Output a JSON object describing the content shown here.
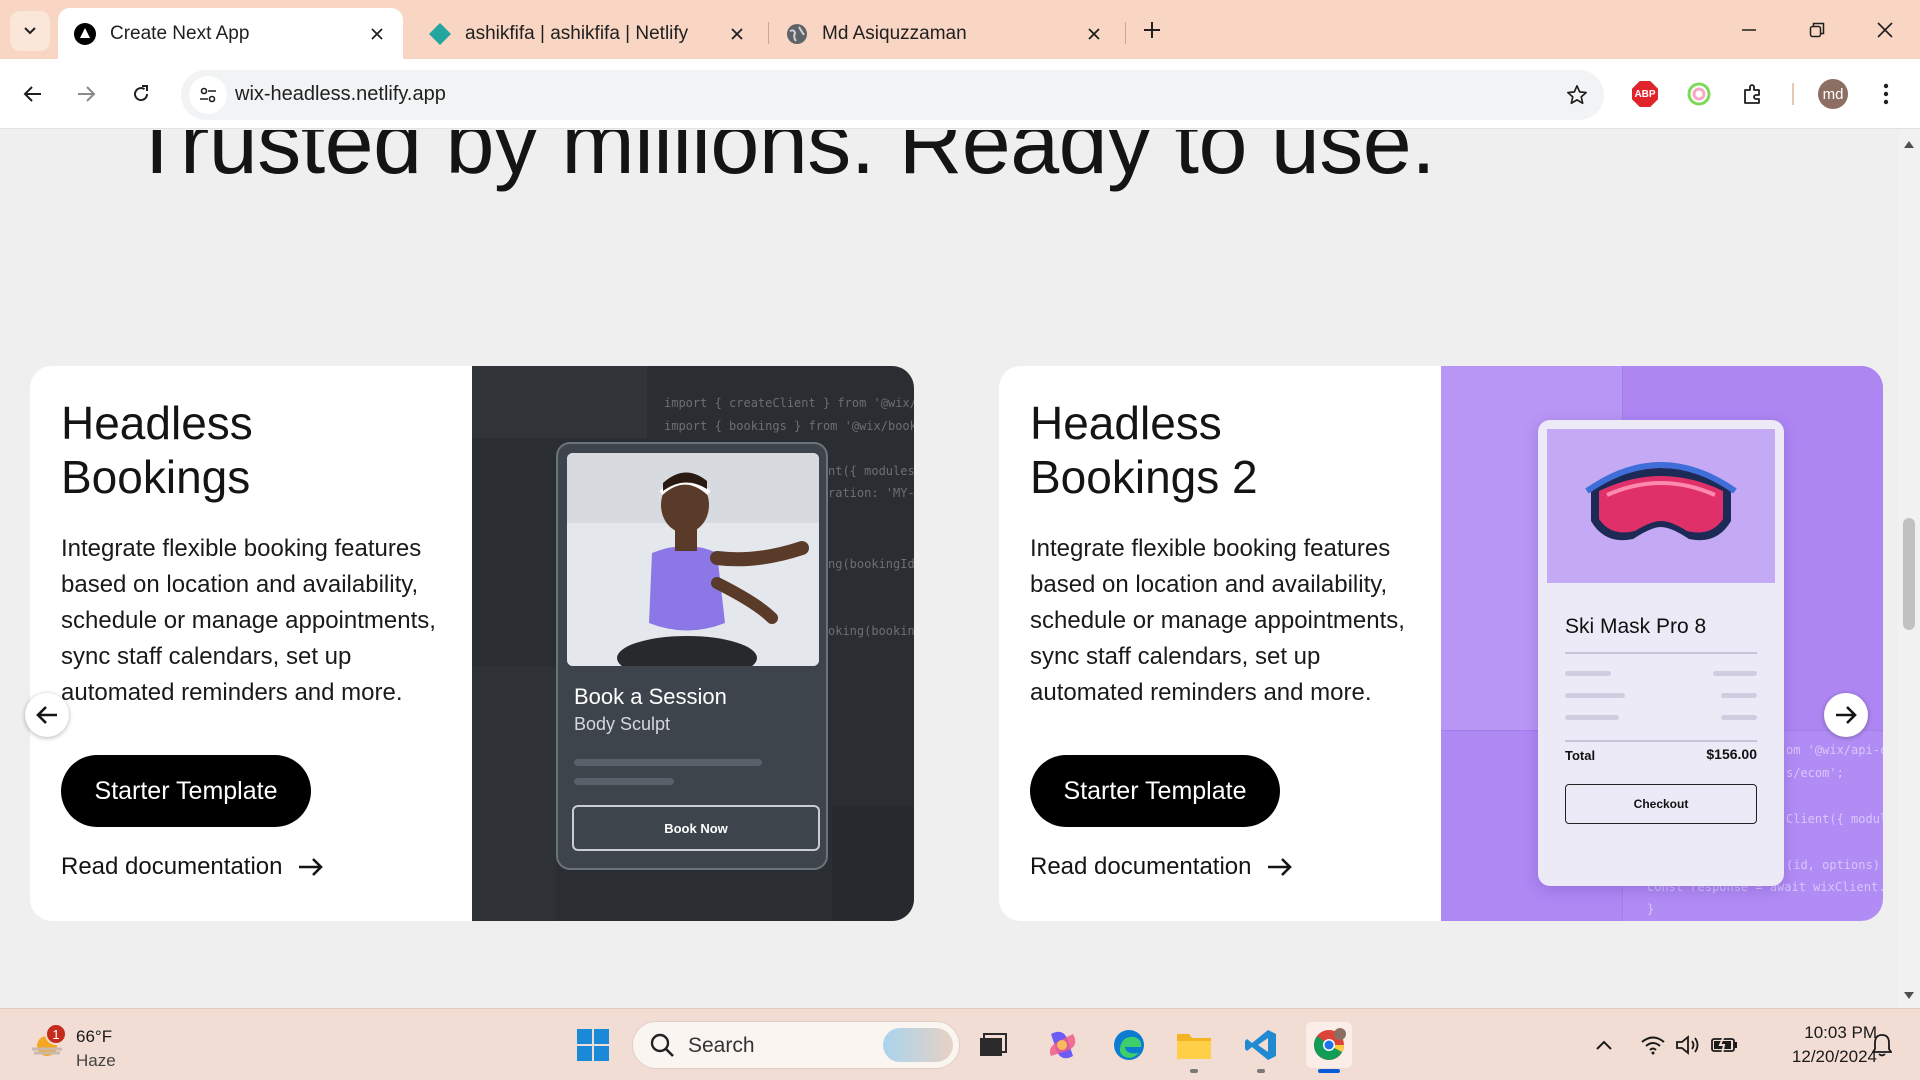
{
  "browser": {
    "tabs": [
      {
        "title": "Create Next App",
        "active": true,
        "favicon": "nextjs-icon"
      },
      {
        "title": "ashikfifa | ashikfifa | Netlify",
        "active": false,
        "favicon": "netlify-icon"
      },
      {
        "title": "Md Asiquzzaman",
        "active": false,
        "favicon": "globe-icon"
      }
    ],
    "url": "wix-headless.netlify.app",
    "profile_initials": "md",
    "abp_label": "ABP"
  },
  "page": {
    "headline": "Trusted by millions. Ready to use.",
    "cards": [
      {
        "title": "Headless Bookings",
        "description": "Integrate flexible booking features based on location and availability, schedule or manage appointments, sync staff calendars, set up automated reminders and more.",
        "button_label": "Starter Template",
        "link_label": "Read documentation",
        "mock": {
          "title": "Book a Session",
          "subtitle": "Body Sculpt",
          "button": "Book Now",
          "code_lines": [
            "import { createClient } from '@wix/api-clien",
            "import { bookings } from '@wix/bookings';",
            "nt({ modules: {",
            "ration: 'MY-TO",
            "ng(bookingId,",
            "oking(booking"
          ]
        }
      },
      {
        "title": "Headless Bookings 2",
        "description": "Integrate flexible booking features based on location and availability, schedule or manage appointments, sync staff calendars, set up automated reminders and more.",
        "button_label": "Starter Template",
        "link_label": "Read documentation",
        "mock": {
          "product": "Ski Mask Pro 8",
          "total_label": "Total",
          "price": "$156.00",
          "button": "Checkout",
          "code_lines": [
            "om '@wix/api-cli",
            "s/ecom';",
            "Client({ modules:",
            "(id, options) {",
            "const response = await wixClient.cart.ad",
            "}"
          ]
        }
      }
    ]
  },
  "taskbar": {
    "weather": {
      "temp": "66°F",
      "condition": "Haze",
      "badge": "1"
    },
    "search_label": "Search",
    "time": "10:03 PM",
    "date": "12/20/2024"
  },
  "colors": {
    "tabbar": "#f9d6c4",
    "dark_panel": "#2a2d31",
    "purple_panel": "#b18cf4",
    "button_black": "#000000"
  }
}
